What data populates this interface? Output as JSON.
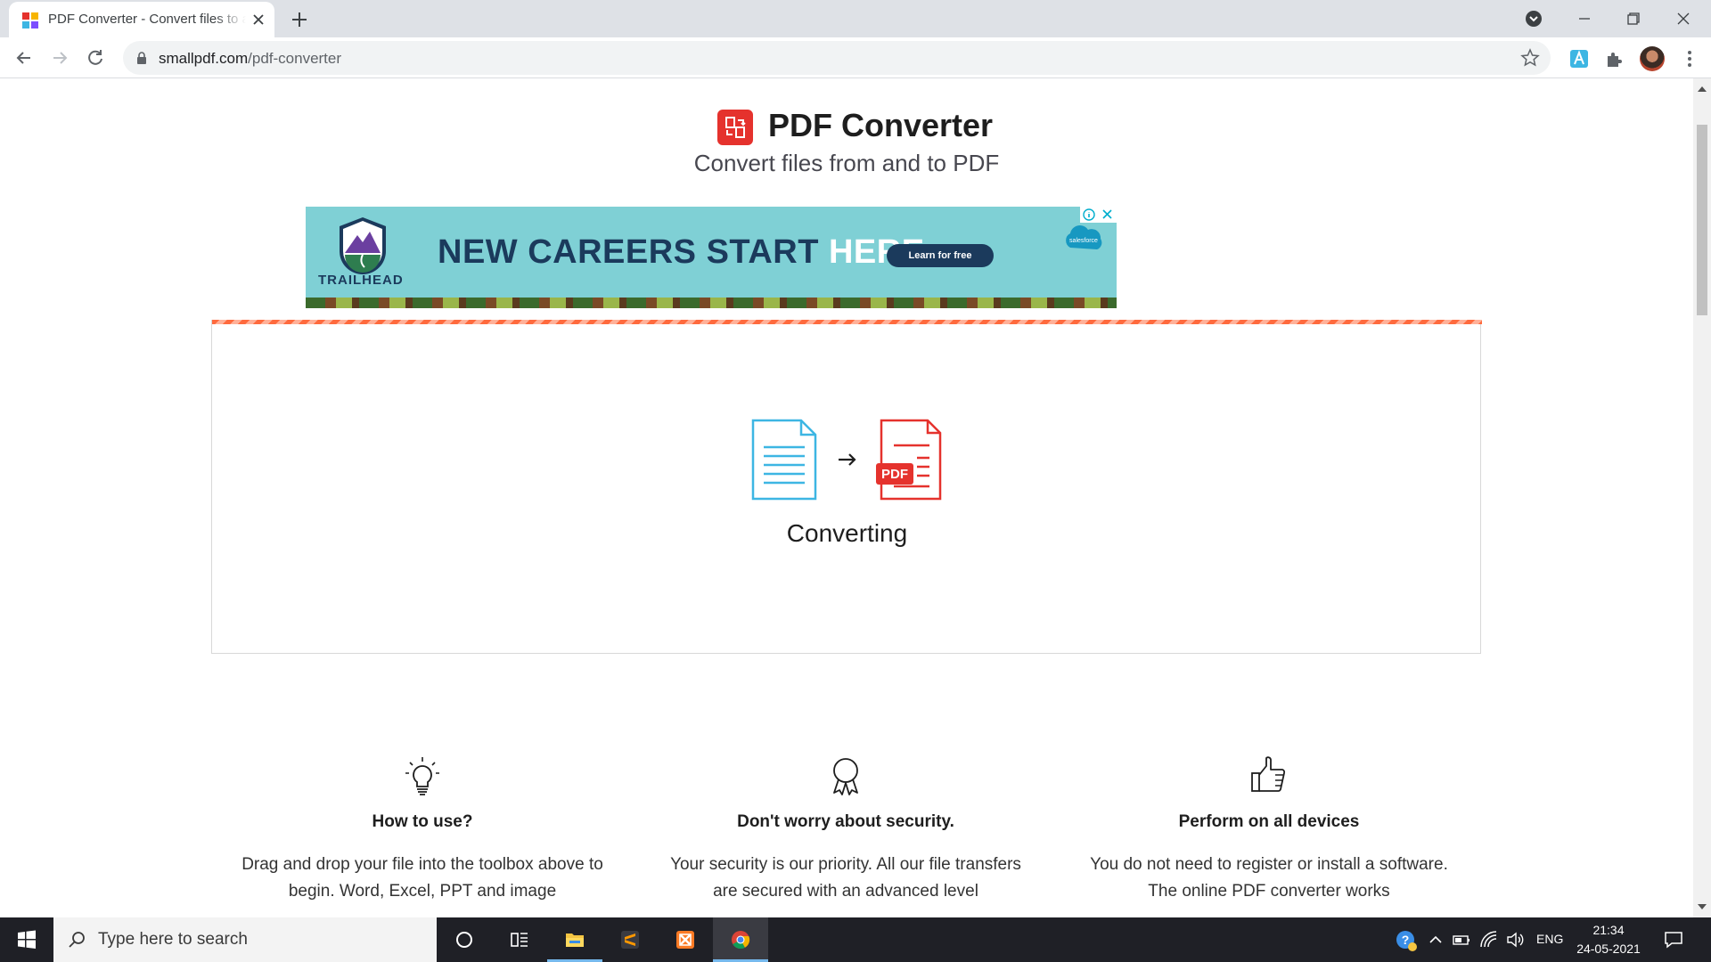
{
  "browser": {
    "tab_title": "PDF Converter - Convert files to and from PDF",
    "url_domain": "smallpdf.com",
    "url_path": "/pdf-converter"
  },
  "hero": {
    "title": "PDF Converter",
    "subtitle": "Convert files from and to PDF"
  },
  "ad": {
    "brand": "TRAILHEAD",
    "headline_main": "NEW CAREERS START ",
    "headline_accent": "HERE.",
    "cta": "Learn for free",
    "sponsor": "salesforce"
  },
  "converter": {
    "status": "Converting",
    "target_badge": "PDF"
  },
  "features": [
    {
      "icon": "lightbulb-icon",
      "title": "How to use?",
      "text": "Drag and drop your file into the toolbox above to begin. Word, Excel, PPT and image"
    },
    {
      "icon": "award-ribbon-icon",
      "title": "Don't worry about security.",
      "text": "Your security is our priority. All our file transfers are secured with an advanced level"
    },
    {
      "icon": "thumbs-up-icon",
      "title": "Perform on all devices",
      "text": "You do not need to register or install a software. The online PDF converter works"
    }
  ],
  "taskbar": {
    "search_placeholder": "Type here to search",
    "language": "ENG",
    "time": "21:34",
    "date": "24-05-2021"
  },
  "colors": {
    "brand_red": "#e5322d",
    "progress_orange": "#ff6a3d",
    "ad_background": "#7fd0d5",
    "ad_navy": "#1b3a5c",
    "doc_blue": "#3db6e3"
  }
}
